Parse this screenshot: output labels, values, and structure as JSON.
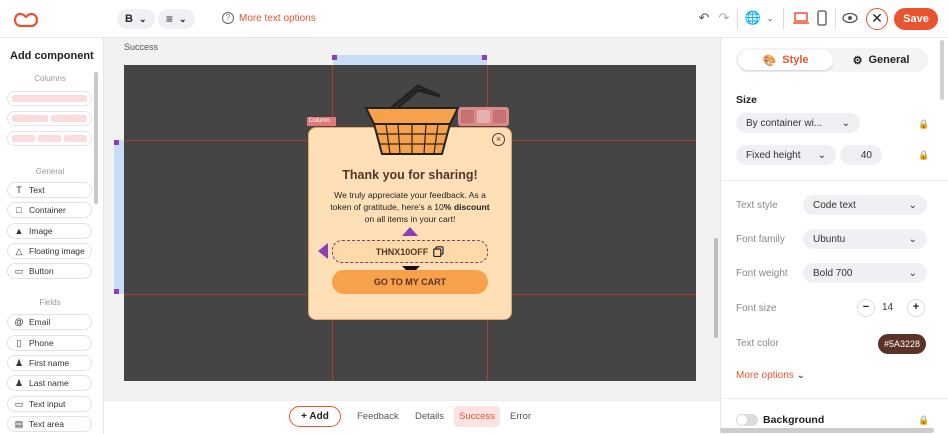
{
  "toolbar": {
    "bold_label": "B",
    "more_text_options": "More text options",
    "save_label": "Save"
  },
  "left_panel": {
    "title": "Add component",
    "sections": {
      "columns": "Columns",
      "general": "General",
      "fields": "Fields"
    },
    "general_items": [
      {
        "label": "Text",
        "icon": "text-icon"
      },
      {
        "label": "Container",
        "icon": "container-icon"
      },
      {
        "label": "Image",
        "icon": "image-icon"
      },
      {
        "label": "Floating image",
        "icon": "floating-image-icon"
      },
      {
        "label": "Button",
        "icon": "button-icon"
      }
    ],
    "field_items": [
      {
        "label": "Email",
        "icon": "at-icon"
      },
      {
        "label": "Phone",
        "icon": "phone-icon"
      },
      {
        "label": "First name",
        "icon": "person-icon"
      },
      {
        "label": "Last name",
        "icon": "person-icon"
      },
      {
        "label": "Text input",
        "icon": "text-input-icon"
      },
      {
        "label": "Text area",
        "icon": "text-area-icon"
      }
    ]
  },
  "canvas": {
    "page_label": "Success",
    "column_tag": "Column",
    "popup": {
      "title": "Thank you for sharing!",
      "body_pre": "We truly appreciate your feedback. As a token of gratitude, here's a 10",
      "body_bold": "% discount",
      "body_post": " on all items in your cart!",
      "coupon_code": "THNX10OFF",
      "cta_label": "GO TO MY CART"
    }
  },
  "bottom": {
    "add_label": "Add",
    "tabs": [
      "Feedback",
      "Details",
      "Success",
      "Error"
    ],
    "active_tab": "Success"
  },
  "right_panel": {
    "tab_style": "Style",
    "tab_general": "General",
    "size_heading": "Size",
    "width_mode": "By container wi...",
    "height_mode": "Fixed height",
    "height_value": "40",
    "text_style_label": "Text style",
    "text_style_value": "Code text",
    "font_family_label": "Font family",
    "font_family_value": "Ubuntu",
    "font_weight_label": "Font weight",
    "font_weight_value": "Bold 700",
    "font_size_label": "Font size",
    "font_size_value": "14",
    "text_color_label": "Text color",
    "text_color_value": "#5A3228",
    "more_options": "More options",
    "background_label": "Background"
  },
  "colors": {
    "accent": "#e8542f",
    "popup_bg": "#ffe0b6",
    "text_brown": "#5a3228",
    "cta": "#f7a24b",
    "canvas_bg": "#454545"
  }
}
